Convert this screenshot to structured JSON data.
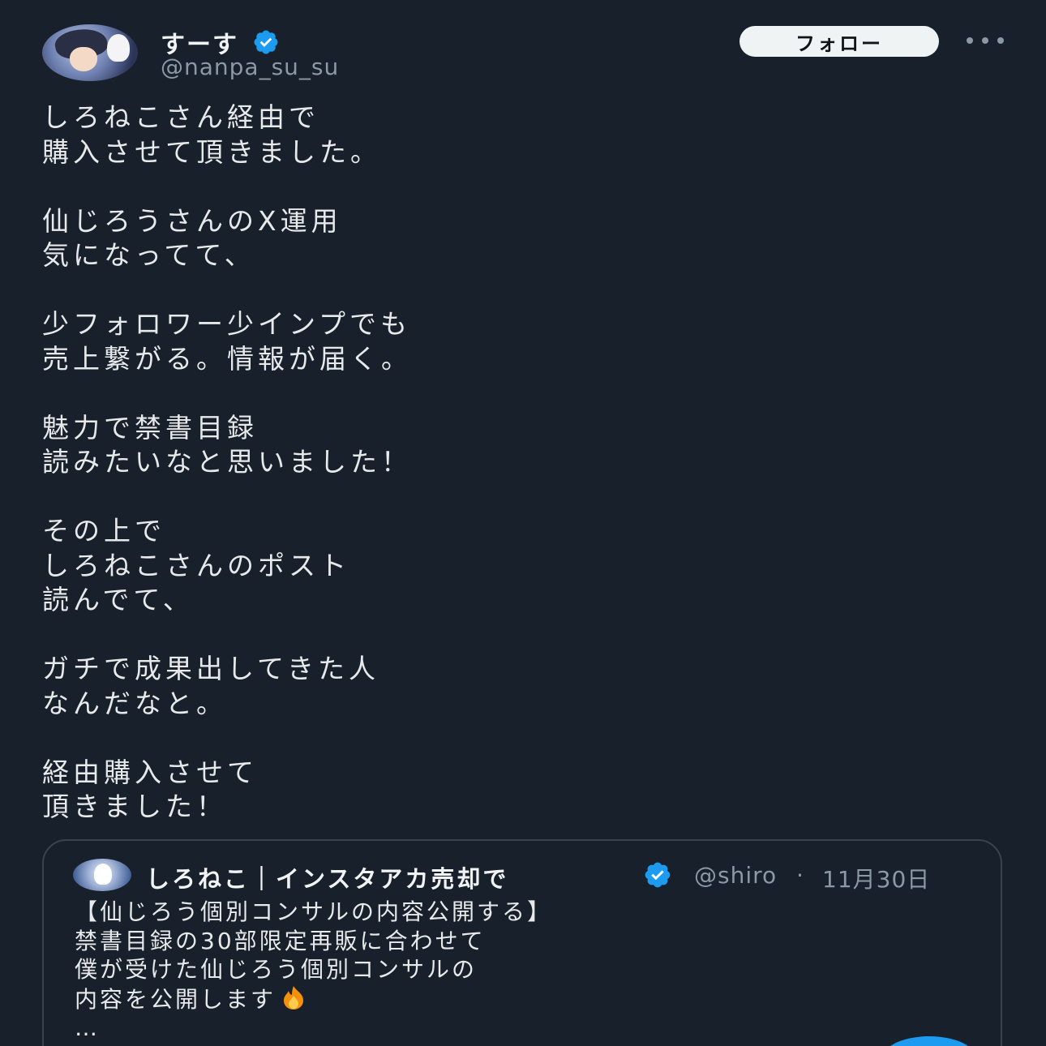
{
  "author": {
    "display_name": "すーす",
    "handle": "@nanpa_su_su",
    "verified": true
  },
  "follow_button_label": "フォロー",
  "more_icon": "more-horizontal-icon",
  "tweet_paragraphs": [
    "しろねこさん経由で\n購入させて頂きました。",
    "仙じろうさんのX運用\n気になってて、",
    "少フォロワー少インプでも\n売上繋がる。情報が届く。",
    "魅力で禁書目録\n読みたいなと思いました！",
    "その上で\nしろねこさんのポスト\n読んでて、",
    "ガチで成果出してきた人\nなんだなと。",
    "経由購入させて\n頂きました！"
  ],
  "quoted_tweet": {
    "display_name": "しろねこ｜インスタアカ売却で",
    "handle": "@shiro",
    "separator": "·",
    "date": "11月30日",
    "lines": [
      "【仙じろう個別コンサルの内容公開する】",
      "禁書目録の30部限定再販に合わせて",
      "僕が受けた仙じろう個別コンサルの",
      "内容を公開します",
      "…"
    ],
    "emoji": "fire-icon"
  },
  "colors": {
    "background": "#17202b",
    "text": "#e7e9ea",
    "muted": "#8b98a5",
    "verified_blue": "#1d9bf0",
    "follow_bg": "#eff3f4",
    "border": "#38444d"
  }
}
